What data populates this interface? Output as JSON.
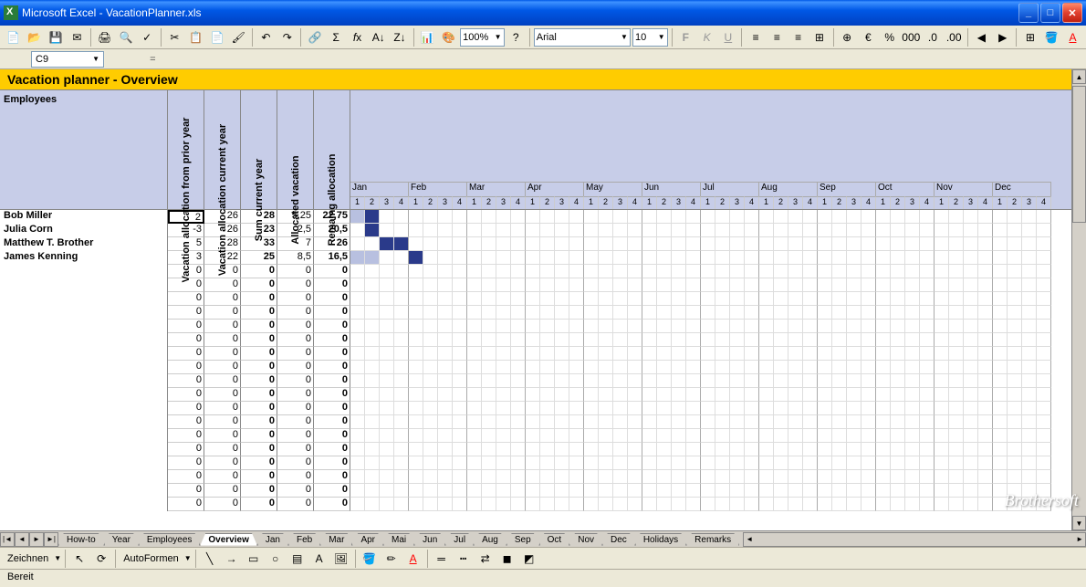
{
  "window": {
    "title": "Microsoft Excel - VacationPlanner.xls"
  },
  "toolbar": {
    "font": "Arial",
    "font_size": "10",
    "zoom": "100%"
  },
  "cell_ref": "C9",
  "formula": "=",
  "sheet_title": "Vacation planner - Overview",
  "headers": {
    "employees": "Employees",
    "cols": [
      "Vacation allocation from prior year",
      "Vacation allocation current year",
      "Sum current year",
      "Allocated vacation",
      "Remaing allocation"
    ]
  },
  "months": [
    "Jan",
    "Feb",
    "Mar",
    "Apr",
    "May",
    "Jun",
    "Jul",
    "Aug",
    "Sep",
    "Oct",
    "Nov",
    "Dec"
  ],
  "weeks": [
    "1",
    "2",
    "3",
    "4"
  ],
  "employees": [
    {
      "name": "Bob Miller",
      "v": [
        "2",
        "26",
        "28",
        "5,25",
        "22,75"
      ],
      "marks": {
        "1": "light",
        "2": "dark"
      }
    },
    {
      "name": "Julia Corn",
      "v": [
        "-3",
        "26",
        "23",
        "2,5",
        "20,5"
      ],
      "marks": {
        "2": "dark"
      }
    },
    {
      "name": "Matthew T. Brother",
      "v": [
        "5",
        "28",
        "33",
        "7",
        "26"
      ],
      "marks": {
        "3": "dark",
        "4": "dark"
      }
    },
    {
      "name": "James Kenning",
      "v": [
        "3",
        "22",
        "25",
        "8,5",
        "16,5"
      ],
      "marks": {
        "1": "light",
        "2": "light",
        "5": "dark"
      }
    }
  ],
  "empty_rows": 18,
  "tabs": [
    "How-to",
    "Year",
    "Employees",
    "Overview",
    "Jan",
    "Feb",
    "Mar",
    "Apr",
    "Mai",
    "Jun",
    "Jul",
    "Aug",
    "Sep",
    "Oct",
    "Nov",
    "Dec",
    "Holidays",
    "Remarks"
  ],
  "active_tab": "Overview",
  "drawing": {
    "label": "Zeichnen",
    "autoshapes": "AutoFormen"
  },
  "status": "Bereit",
  "watermark": "Brothersoft"
}
